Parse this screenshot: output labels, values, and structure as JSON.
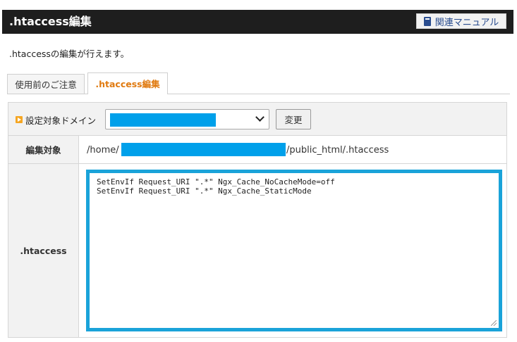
{
  "header": {
    "title": ".htaccess編集",
    "manual_button": "関連マニュアル"
  },
  "description": ".htaccessの編集が行えます。",
  "tabs": [
    {
      "label": "使用前のご注意",
      "active": false
    },
    {
      "label": ".htaccess編集",
      "active": true
    }
  ],
  "domain_row": {
    "label": "設定対象ドメイン",
    "change_button": "変更"
  },
  "target_row": {
    "label": "編集対象",
    "path_prefix": "/home/",
    "path_suffix": "/public_html/.htaccess"
  },
  "htaccess_row": {
    "label": ".htaccess",
    "lines": [
      "SetEnvIf Request_URI \".*\" Ngx_Cache_NoCacheMode=off",
      "SetEnvIf Request_URI \".*\" Ngx_Cache_StaticMode"
    ]
  },
  "colors": {
    "header_bg": "#1e1e1e",
    "active_tab_text": "#e07a10",
    "editor_border": "#1aa3d9",
    "redaction": "#00a0ea"
  }
}
